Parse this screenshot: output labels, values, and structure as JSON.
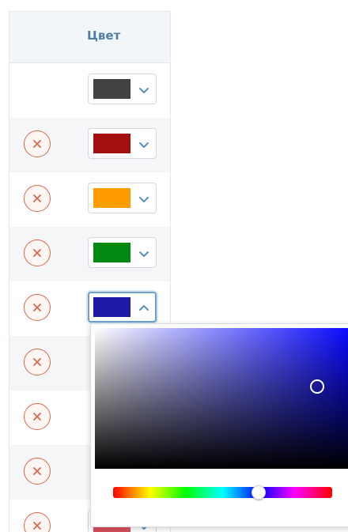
{
  "table": {
    "header": {
      "color_label": "Цвет"
    },
    "rows": [
      {
        "removable": false,
        "color": "#424242",
        "open": false
      },
      {
        "removable": true,
        "color": "#a30f0f",
        "open": false
      },
      {
        "removable": true,
        "color": "#ff9c00",
        "open": false
      },
      {
        "removable": true,
        "color": "#008a12",
        "open": false
      },
      {
        "removable": true,
        "color": "#1f1aa6",
        "open": true
      },
      {
        "removable": true,
        "color": null,
        "open": false
      },
      {
        "removable": true,
        "color": null,
        "open": false
      },
      {
        "removable": true,
        "color": null,
        "open": false
      },
      {
        "removable": true,
        "color": "#d8505e",
        "open": false
      }
    ]
  },
  "icons": {
    "remove": "close-icon",
    "dropdown_closed": "chevron-down-icon",
    "dropdown_open": "chevron-up-icon"
  },
  "colors": {
    "header_text": "#4f7fa7",
    "remove_border": "#d9684e",
    "focus_border": "#6fa0c8"
  },
  "color_picker": {
    "hue_color": "#0000ff",
    "hue_position_fraction": 0.67,
    "saturation_fraction": 0.83,
    "brightness_fraction": 0.58
  }
}
